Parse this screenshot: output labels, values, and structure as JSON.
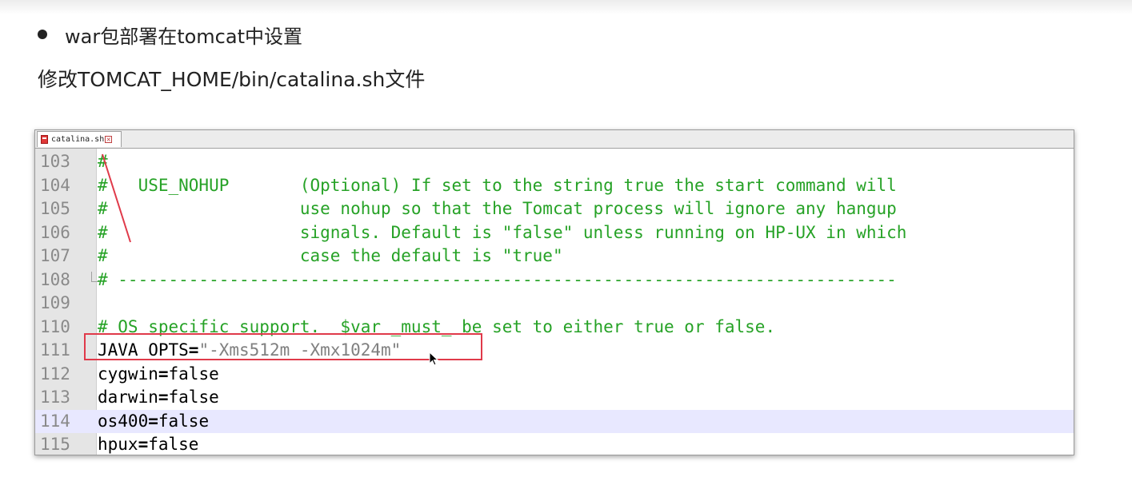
{
  "header": {
    "bullet_text": "war包部署在tomcat中设置",
    "subtitle": "修改TOMCAT_HOME/bin/catalina.sh文件"
  },
  "editor": {
    "tab_label": "catalina.sh",
    "lines": {
      "l103": {
        "num": "103",
        "text": "#"
      },
      "l104": {
        "num": "104",
        "text": "#   USE_NOHUP       (Optional) If set to the string true the start command will"
      },
      "l105": {
        "num": "105",
        "text": "#                   use nohup so that the Tomcat process will ignore any hangup"
      },
      "l106": {
        "num": "106",
        "text": "#                   signals. Default is \"false\" unless running on HP-UX in which"
      },
      "l107": {
        "num": "107",
        "text": "#                   case the default is \"true\""
      },
      "l108": {
        "num": "108",
        "text": "# -----------------------------------------------------------------------------"
      },
      "l109": {
        "num": "109",
        "text": ""
      },
      "l110": {
        "num": "110",
        "text": "# OS specific support.  $var _must_ be set to either true or false."
      },
      "l111": {
        "num": "111",
        "key": "JAVA_OPTS",
        "op": "=",
        "value": "\"-Xms512m -Xmx1024m\""
      },
      "l112": {
        "num": "112",
        "key": "cygwin",
        "op": "=",
        "value": "false"
      },
      "l113": {
        "num": "113",
        "key": "darwin",
        "op": "=",
        "value": "false"
      },
      "l114": {
        "num": "114",
        "key": "os400",
        "op": "=",
        "value": "false"
      },
      "l115": {
        "num": "115",
        "key": "hpux",
        "op": "=",
        "value": "false"
      }
    }
  },
  "colors": {
    "comment": "#26a226",
    "string": "#808080",
    "highlight_box": "#e03a4a",
    "current_line": "#e8e8ff"
  }
}
